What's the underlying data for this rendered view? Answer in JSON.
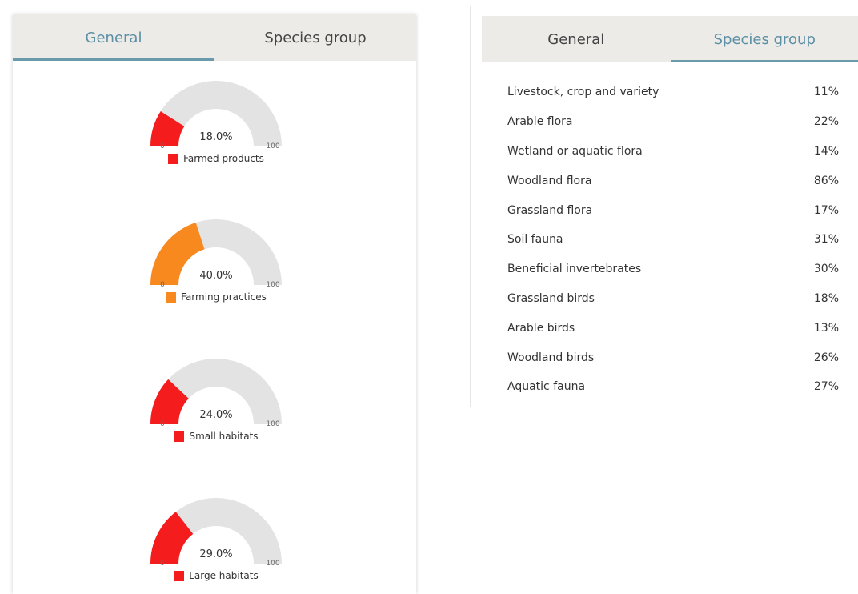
{
  "left_panel": {
    "tabs": [
      {
        "label": "General",
        "active": true
      },
      {
        "label": "Species group",
        "active": false
      }
    ],
    "gauges": [
      {
        "value_label": "18.0%",
        "value": 18.0,
        "min_label": "0",
        "max_label": "100",
        "legend": "Farmed products",
        "color": "#f41c1c"
      },
      {
        "value_label": "40.0%",
        "value": 40.0,
        "min_label": "0",
        "max_label": "100",
        "legend": "Farming practices",
        "color": "#f7891e"
      },
      {
        "value_label": "24.0%",
        "value": 24.0,
        "min_label": "0",
        "max_label": "100",
        "legend": "Small habitats",
        "color": "#f41c1c"
      },
      {
        "value_label": "29.0%",
        "value": 29.0,
        "min_label": "0",
        "max_label": "100",
        "legend": "Large habitats",
        "color": "#f41c1c"
      }
    ],
    "gauge_track_color": "#e3e3e3"
  },
  "right_panel": {
    "tabs": [
      {
        "label": "General",
        "active": false
      },
      {
        "label": "Species group",
        "active": true
      }
    ],
    "species": [
      {
        "name": "Livestock, crop and variety",
        "value": "11%"
      },
      {
        "name": "Arable flora",
        "value": "22%"
      },
      {
        "name": "Wetland or aquatic flora",
        "value": "14%"
      },
      {
        "name": "Woodland flora",
        "value": "86%"
      },
      {
        "name": "Grassland flora",
        "value": "17%"
      },
      {
        "name": "Soil fauna",
        "value": "31%"
      },
      {
        "name": "Beneficial invertebrates",
        "value": "30%"
      },
      {
        "name": "Grassland birds",
        "value": "18%"
      },
      {
        "name": "Arable birds",
        "value": "13%"
      },
      {
        "name": "Woodland birds",
        "value": "26%"
      },
      {
        "name": "Aquatic fauna",
        "value": "27%"
      }
    ]
  }
}
